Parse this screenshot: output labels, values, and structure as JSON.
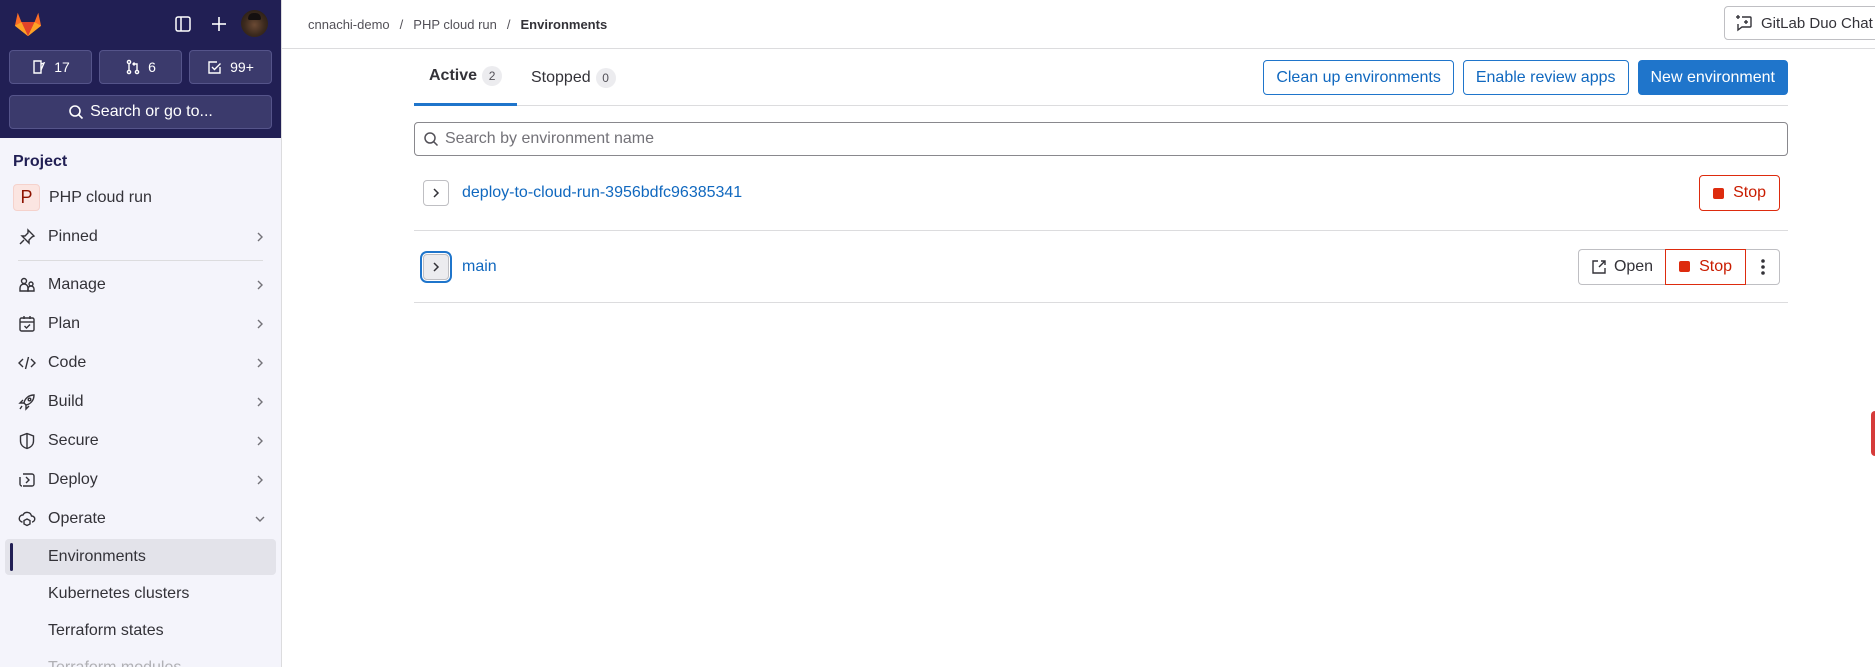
{
  "sidebar": {
    "top_icons": {
      "toggle_sidebar": "sidebar-toggle-icon",
      "create_new": "plus-icon",
      "avatar": "user-avatar"
    },
    "counts": [
      {
        "icon": "issues-icon",
        "value": "17"
      },
      {
        "icon": "merge-request-icon",
        "value": "6"
      },
      {
        "icon": "todo-icon",
        "value": "99+"
      }
    ],
    "search_label": "Search or go to...",
    "section_heading": "Project",
    "project": {
      "initial": "P",
      "name": "PHP cloud run"
    },
    "items": [
      {
        "label": "Pinned",
        "icon": "pin-icon",
        "expanded": false
      },
      {
        "label": "Manage",
        "icon": "users-icon",
        "expanded": false
      },
      {
        "label": "Plan",
        "icon": "calendar-icon",
        "expanded": false
      },
      {
        "label": "Code",
        "icon": "code-icon",
        "expanded": false
      },
      {
        "label": "Build",
        "icon": "rocket-icon",
        "expanded": false
      },
      {
        "label": "Secure",
        "icon": "shield-icon",
        "expanded": false
      },
      {
        "label": "Deploy",
        "icon": "deploy-icon",
        "expanded": false
      },
      {
        "label": "Operate",
        "icon": "cloud-gear-icon",
        "expanded": true
      }
    ],
    "operate_subitems": [
      {
        "label": "Environments",
        "active": true
      },
      {
        "label": "Kubernetes clusters",
        "active": false
      },
      {
        "label": "Terraform states",
        "active": false
      },
      {
        "label": "Terraform modules",
        "active": false
      }
    ]
  },
  "header": {
    "breadcrumb": [
      "cnnachi-demo",
      "PHP cloud run",
      "Environments"
    ],
    "breadcrumb_separator": "/",
    "duo_chat_label": "GitLab Duo Chat"
  },
  "main": {
    "tabs": [
      {
        "label": "Active",
        "count": "2",
        "active": true
      },
      {
        "label": "Stopped",
        "count": "0",
        "active": false
      }
    ],
    "actions": {
      "cleanup": "Clean up environments",
      "review_apps": "Enable review apps",
      "new_env": "New environment"
    },
    "search": {
      "placeholder": "Search by environment name",
      "value": ""
    },
    "environments": [
      {
        "name": "deploy-to-cloud-run-3956bdfc96385341",
        "open_label": null,
        "stop_label": "Stop"
      },
      {
        "name": "main",
        "open_label": "Open",
        "stop_label": "Stop"
      }
    ]
  },
  "colors": {
    "sidebar_top": "#211f54",
    "primary": "#1f75cb",
    "danger": "#dd2b0e",
    "link": "#1068bf"
  }
}
